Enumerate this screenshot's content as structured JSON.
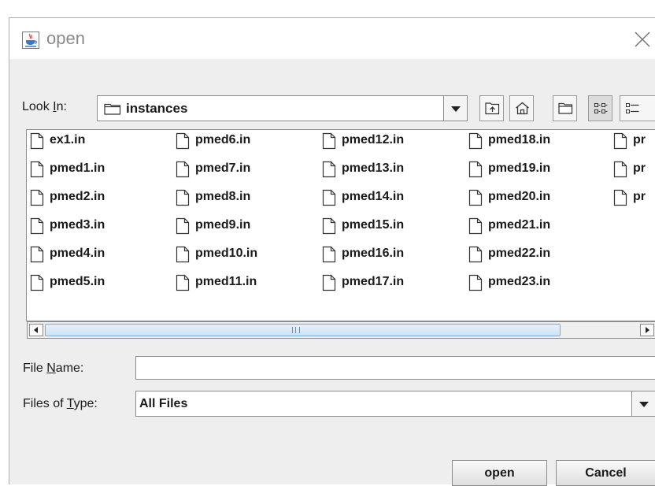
{
  "title": "open",
  "look_in": {
    "label_prefix": "Look ",
    "label_mnemonic": "I",
    "label_suffix": "n:",
    "value": "instances"
  },
  "toolbar": {
    "buttons": [
      {
        "name": "up-one-level"
      },
      {
        "name": "home"
      },
      {
        "name": "create-new-folder"
      },
      {
        "name": "list-view"
      },
      {
        "name": "details-view"
      }
    ]
  },
  "files": {
    "columns": [
      [
        "ex1.in",
        "pmed1.in",
        "pmed2.in",
        "pmed3.in",
        "pmed4.in",
        "pmed5.in"
      ],
      [
        "pmed6.in",
        "pmed7.in",
        "pmed8.in",
        "pmed9.in",
        "pmed10.in",
        "pmed11.in"
      ],
      [
        "pmed12.in",
        "pmed13.in",
        "pmed14.in",
        "pmed15.in",
        "pmed16.in",
        "pmed17.in"
      ],
      [
        "pmed18.in",
        "pmed19.in",
        "pmed20.in",
        "pmed21.in",
        "pmed22.in",
        "pmed23.in"
      ],
      [
        "pr",
        "pr",
        "pr"
      ]
    ]
  },
  "file_name": {
    "label_prefix": "File ",
    "label_mnemonic": "N",
    "label_suffix": "ame:",
    "value": ""
  },
  "files_of_type": {
    "label_prefix": "Files of ",
    "label_mnemonic": "T",
    "label_suffix": "ype:",
    "value": "All Files"
  },
  "buttons": {
    "open": "open",
    "cancel": "Cancel"
  }
}
